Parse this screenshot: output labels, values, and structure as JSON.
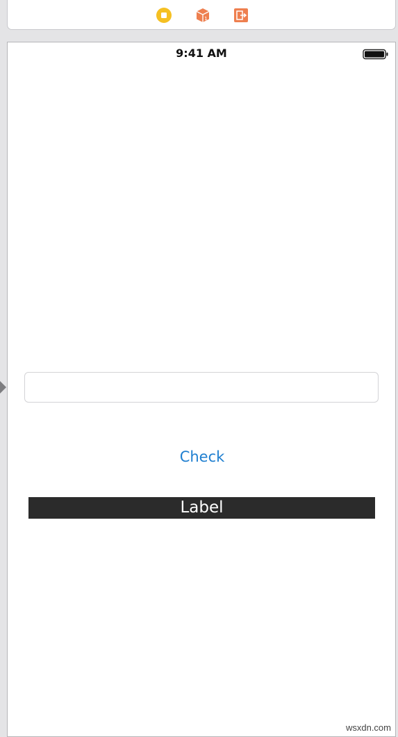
{
  "scene_dock": {
    "icons": [
      "view-controller-icon",
      "first-responder-icon",
      "exit-icon"
    ],
    "colors": {
      "view_controller": "#f5c022",
      "first_responder": "#ee7f4f",
      "exit": "#ee7f4f"
    }
  },
  "status_bar": {
    "time": "9:41 AM"
  },
  "text_field": {
    "value": "",
    "placeholder": ""
  },
  "check_button": {
    "label": "Check",
    "color": "#1f7fd0"
  },
  "result_label": {
    "text": "Label",
    "background": "#2b2b2b"
  },
  "watermark": "wsxdn.com"
}
